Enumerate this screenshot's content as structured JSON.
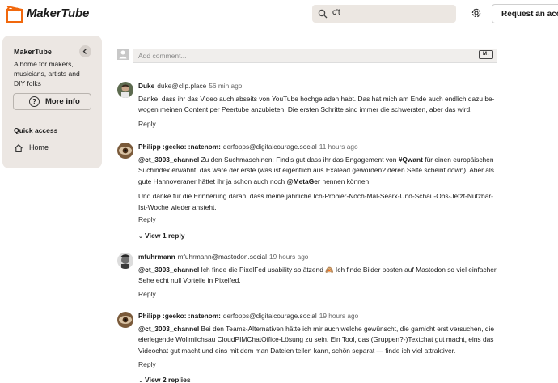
{
  "header": {
    "brand": "MakerTube",
    "search_value": "c't",
    "request_button": "Request an account"
  },
  "sidebar": {
    "title": "MakerTube",
    "description": "A home for makers, musicians, artists and DIY folks",
    "more_info": "More info",
    "quick_access": "Quick access",
    "home": "Home"
  },
  "add_comment": {
    "placeholder": "Add comment...",
    "markdown_badge": "M↓"
  },
  "comments": [
    {
      "display_name": "Duke",
      "handle": "duke@clip.place",
      "time": "56 min ago",
      "body_l1": "Danke, dass ihr das Video auch abseits von YouTube hochgeladen habt. Das hat mich am Ende auch endlich dazu be-",
      "body_l2": "wogen meinen Content per Peertube anzubieten. Die ersten Schritte sind immer die schwersten, aber das wird.",
      "reply": "Reply"
    },
    {
      "display_name": "Philipp :geeko: :natenom:",
      "handle": "derfopps@digitalcourage.social",
      "time": "11 hours ago",
      "mention": "@ct_3003_channel",
      "p1_a": " Zu den Suchmaschinen: Find's gut dass ihr das Engagement von ",
      "hashtag": "#Qwant",
      "p1_b": " für einen europäischen Suchindex erwähnt, das wäre der erste (was ist eigentlich aus Exalead geworden? deren Seite scheint down). Aber als gute Hannoveraner hättet ihr ja schon auch noch ",
      "mention2": "@MetaGer",
      "p1_c": " nennen können.",
      "p2": "Und danke für die Erinnerung daran, dass meine jährliche Ich-Probier-Noch-Mal-Searx-Und-Schau-Obs-Jetzt-Nutzbar-Ist-Woche wieder ansteht.",
      "reply": "Reply",
      "view_replies": "View 1 reply"
    },
    {
      "display_name": "mfuhrmann",
      "handle": "mfuhrmann@mastodon.social",
      "time": "19 hours ago",
      "mention": "@ct_3003_channel",
      "body": " Ich finde die PixelFed usability so ätzend 🙈 Ich finde Bilder posten auf Mastodon so viel einfacher. Sehe echt null Vorteile in Pixelfed.",
      "reply": "Reply"
    },
    {
      "display_name": "Philipp :geeko: :natenom:",
      "handle": "derfopps@digitalcourage.social",
      "time": "19 hours ago",
      "mention": "@ct_3003_channel",
      "body": " Bei den Teams-Alternativen hätte ich mir auch welche gewünscht, die garnicht erst versuchen, die eierlegende Wollmilchsau CloudPIMChatOffice-Lösung zu sein. Ein Tool, das (Gruppen?-)Textchat gut macht, eins das Videochat gut macht und eins mit dem man Dateien teilen kann, schön separat — finde ich viel attraktiver.",
      "reply": "Reply",
      "view_replies": "View 2 replies"
    }
  ],
  "colors": {
    "brand_orange": "#f1680d",
    "sidebar_bg": "#ece7e3",
    "search_bg": "#ece7e2"
  }
}
